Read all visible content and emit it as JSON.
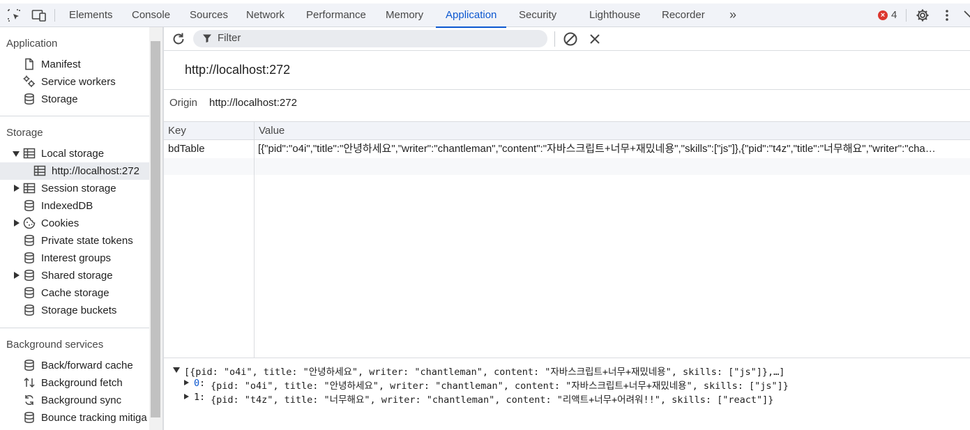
{
  "devtools_tabs": [
    {
      "label": "Elements"
    },
    {
      "label": "Console"
    },
    {
      "label": "Sources"
    },
    {
      "label": "Network"
    },
    {
      "label": "Performance"
    },
    {
      "label": "Memory"
    },
    {
      "label": "Application",
      "active": true
    },
    {
      "label": "Security"
    },
    {
      "label": "Lighthouse"
    },
    {
      "label": "Recorder"
    }
  ],
  "error_count": "4",
  "sidebar": {
    "application_title": "Application",
    "application_items": [
      "Manifest",
      "Service workers",
      "Storage"
    ],
    "storage_title": "Storage",
    "local_storage": "Local storage",
    "local_storage_origin": "http://localhost:272",
    "storage_items": [
      "Session storage",
      "IndexedDB",
      "Cookies",
      "Private state tokens",
      "Interest groups",
      "Shared storage",
      "Cache storage",
      "Storage buckets"
    ],
    "background_title": "Background services",
    "background_items": [
      "Back/forward cache",
      "Background fetch",
      "Background sync",
      "Bounce tracking mitiga"
    ]
  },
  "toolbar": {
    "filter_placeholder": "Filter"
  },
  "main": {
    "header_url": "http://localhost:272",
    "origin_label": "Origin",
    "origin_value": "http://localhost:272"
  },
  "table": {
    "columns": [
      "Key",
      "Value"
    ],
    "rows": [
      {
        "key": "bdTable",
        "value": "[{\"pid\":\"o4i\",\"title\":\"안녕하세요\",\"writer\":\"chantleman\",\"content\":\"자바스크립트+너무+재밌네용\",\"skills\":[\"js\"]},{\"pid\":\"t4z\",\"title\":\"너무해요\",\"writer\":\"cha…"
      }
    ]
  },
  "preview": {
    "summary": "[{pid: \"o4i\", title: \"안녕하세요\", writer: \"chantleman\", content: \"자바스크립트+너무+재밌네용\", skills: [\"js\"]},…]",
    "items": [
      {
        "index": "0",
        "text": "{pid: \"o4i\", title: \"안녕하세요\", writer: \"chantleman\", content: \"자바스크립트+너무+재밌네용\", skills: [\"js\"]}"
      },
      {
        "index": "1",
        "text": "{pid: \"t4z\", title: \"너무해요\", writer: \"chantleman\", content: \"리액트+너무+어려워!!\", skills: [\"react\"]}"
      }
    ]
  }
}
